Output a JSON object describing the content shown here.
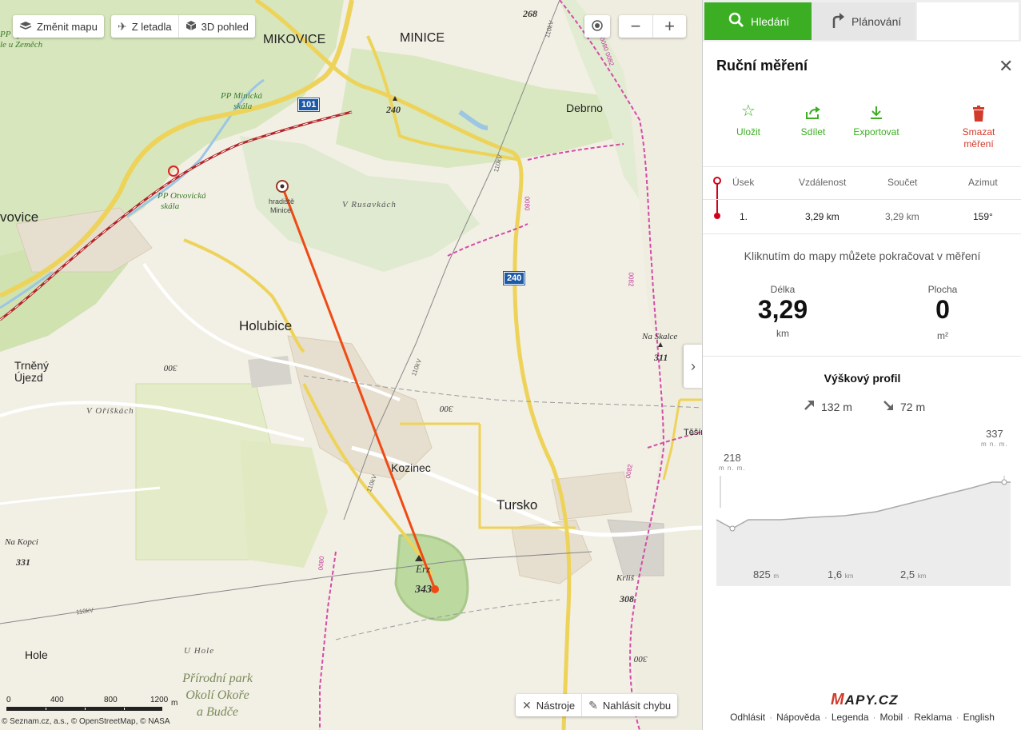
{
  "map": {
    "controls": {
      "change_map": "Změnit mapu",
      "aerial": "Z letadla",
      "view3d": "3D pohled",
      "tools": "Nástroje",
      "report": "Nahlásit chybu"
    },
    "labels": {
      "mikovice": "MIKOVICE",
      "minice": "MINICE",
      "debrno": "Debrno",
      "otvovice": "vovice",
      "holubice": "Holubice",
      "trneny_ujezd_1": "Trněný",
      "trneny_ujezd_2": "Újezd",
      "kozinec": "Kozinec",
      "tursko": "Tursko",
      "hole": "Hole",
      "tesin": "Těšín",
      "pp_minicka_1": "PP Minická",
      "pp_minicka_2": "skála",
      "pp_otvovicka_1": "PP Otvovická",
      "pp_otvovicka_2": "skála",
      "pp_spravce_1": "PP Správča",
      "pp_spravce_2": "le u Zeměch",
      "hradiste_1": "hradiště",
      "hradiste_2": "Minice",
      "v_rusavkach": "V Rusavkách",
      "v_oriskach": "V Oříškách",
      "u_hole": "U Hole",
      "park_1": "Přírodní park",
      "park_2": "Okolí Okoře",
      "park_3": "a Budče",
      "na_skalce": "Na Skalce",
      "na_skalce_elev": "311",
      "na_kopci": "Na Kopci",
      "na_kopci_elev": "331",
      "erz": "Erz",
      "erz_elev": "343",
      "krlis": "Krliš",
      "krlis_elev": "308",
      "elev_240": "240",
      "elev_268": "268",
      "contour_300a": "300",
      "contour_300b": "300",
      "contour_300c": "300",
      "line_110kv_a": "110kV",
      "line_110kv_b": "110kV",
      "line_110kv_c": "110kV",
      "line_110kv_d": "110kV",
      "line_110kv_e": "110kV",
      "rail_0080a": "0080",
      "rail_0080b": "0080",
      "rail_0082a": "0082",
      "rail_0082b": "0082",
      "rail_0080_0082": "0080 0082",
      "road_101": "101",
      "road_240": "240"
    },
    "scale": {
      "ticks": [
        "0",
        "400",
        "800",
        "1200"
      ],
      "unit": "m"
    },
    "copyright": "© Seznam.cz, a.s., © OpenStreetMap, © NASA"
  },
  "panel": {
    "tabs": {
      "search": "Hledání",
      "planning": "Plánování"
    },
    "title": "Ruční měření",
    "actions": {
      "save": "Uložit",
      "share": "Sdílet",
      "export": "Exportovat",
      "delete_1": "Smazat",
      "delete_2": "měření"
    },
    "table": {
      "headers": {
        "segment": "Úsek",
        "distance": "Vzdálenost",
        "total": "Součet",
        "azimuth": "Azimut"
      },
      "rows": [
        {
          "segment": "1.",
          "distance": "3,29 km",
          "total": "3,29 km",
          "azimuth": "159°"
        }
      ]
    },
    "hint": "Kliknutím do mapy můžete pokračovat v měření",
    "length": {
      "label": "Délka",
      "value": "3,29",
      "unit": "km"
    },
    "area": {
      "label": "Plocha",
      "value": "0",
      "unit": "m²"
    },
    "profile": {
      "title": "Výškový profil",
      "ascent": "132 m",
      "descent": "72 m",
      "start_elev": "218",
      "end_elev": "337",
      "elev_unit": "m n. m.",
      "x_labels": [
        {
          "value": "825",
          "unit": "m"
        },
        {
          "value": "1,6",
          "unit": "km"
        },
        {
          "value": "2,5",
          "unit": "km"
        }
      ]
    },
    "logo": {
      "m": "M",
      "rest": "APY.CZ"
    },
    "footer": [
      "Odhlásit",
      "Nápověda",
      "Legenda",
      "Mobil",
      "Reklama",
      "English"
    ],
    "colors": {
      "accent": "#3bae23",
      "danger": "#d23a2a",
      "measure_line": "#f04a14"
    }
  }
}
